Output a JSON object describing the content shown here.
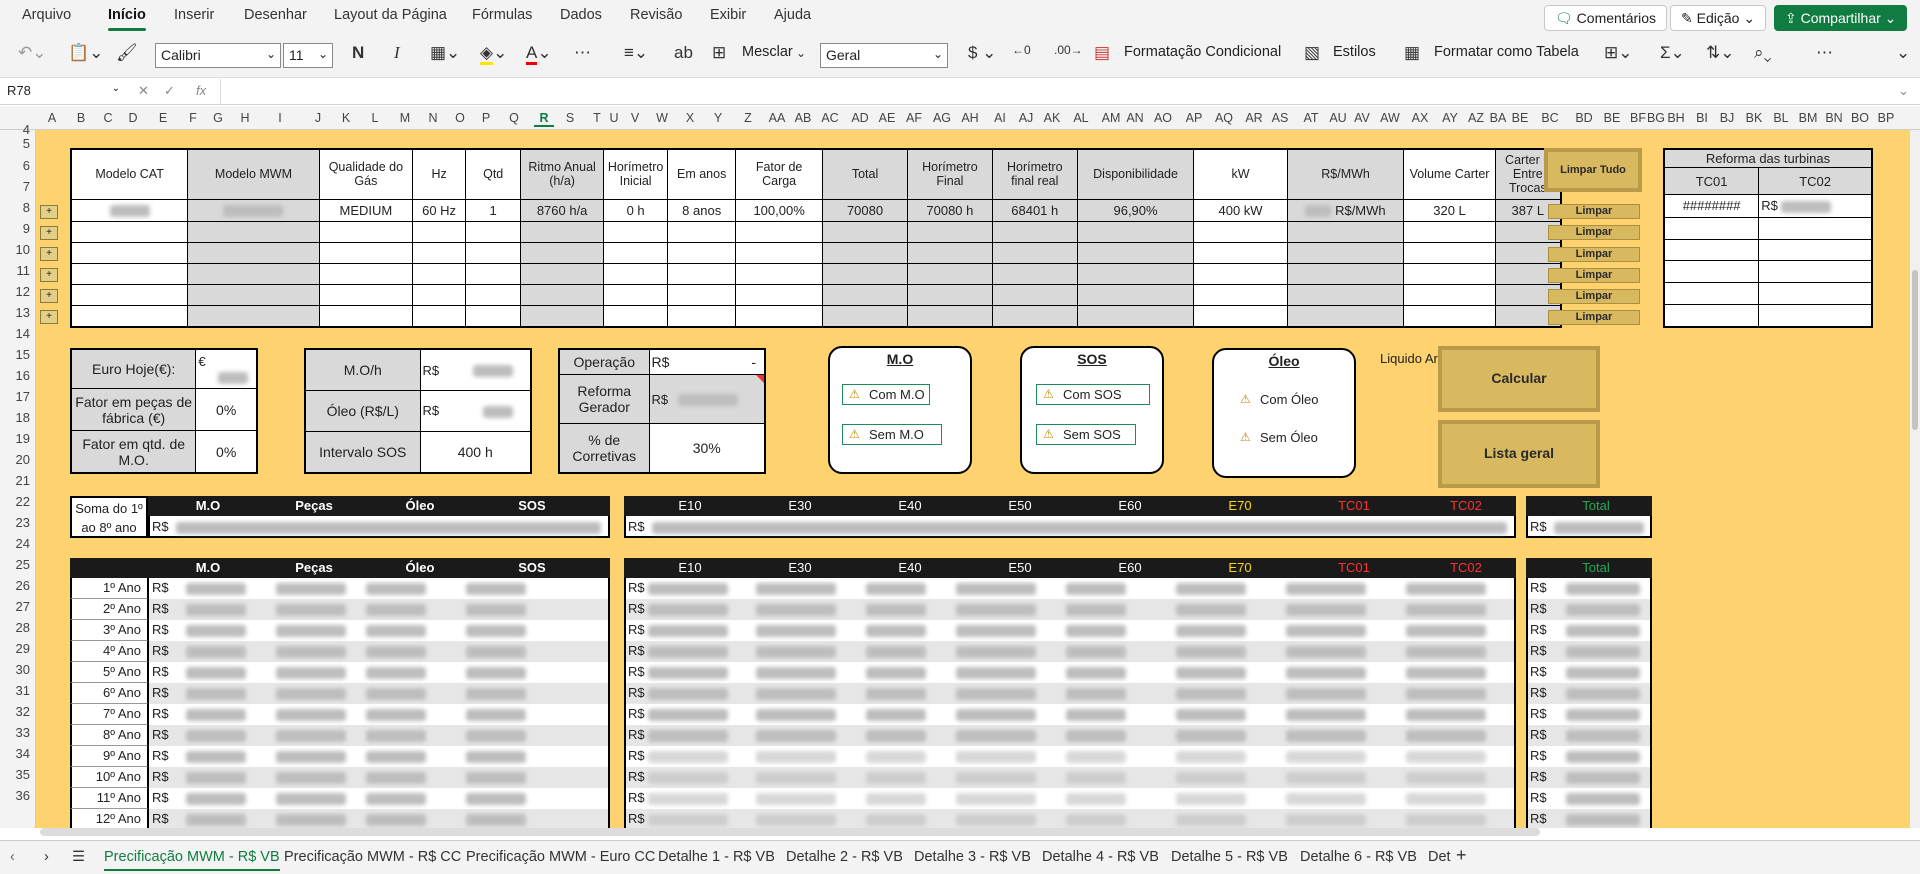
{
  "ribbon": {
    "tabs": [
      "Arquivo",
      "Início",
      "Inserir",
      "Desenhar",
      "Layout da Página",
      "Fórmulas",
      "Dados",
      "Revisão",
      "Exibir",
      "Ajuda"
    ],
    "comments": "Comentários",
    "edit": "Edição",
    "share": "Compartilhar"
  },
  "toolbar": {
    "font": "Calibri",
    "size": "11",
    "merge": "Mesclar",
    "format": "Geral",
    "cond_format": "Formatação Condicional",
    "styles": "Estilos",
    "format_table": "Formatar como Tabela"
  },
  "formula": {
    "cell": "R78",
    "fx": "fx"
  },
  "columns": [
    "A",
    "B",
    "C",
    "D",
    "E",
    "F",
    "G",
    "H",
    "I",
    "J",
    "K",
    "L",
    "M",
    "N",
    "O",
    "P",
    "Q",
    "R",
    "S",
    "T",
    "U",
    "V",
    "W",
    "X",
    "Y",
    "Z",
    "AA",
    "AB",
    "AC",
    "AD",
    "AE",
    "AF",
    "AG",
    "AH",
    "AI",
    "AJ",
    "AK",
    "AL",
    "AM",
    "AN",
    "AO",
    "AP",
    "AQ",
    "AR",
    "AS",
    "AT",
    "AU",
    "AV",
    "AW",
    "AX",
    "AY",
    "AZ",
    "BA",
    "BE",
    "BC",
    "BD",
    "BE",
    "BF",
    "BG",
    "BH",
    "BI",
    "BJ",
    "BK",
    "BL",
    "BM",
    "BN",
    "BO",
    "BP"
  ],
  "rows": [
    "4",
    "5",
    "6",
    "7",
    "8",
    "9",
    "10",
    "11",
    "12",
    "13",
    "14",
    "15",
    "16",
    "17",
    "18",
    "19",
    "20",
    "21",
    "22",
    "23",
    "24",
    "25",
    "26",
    "27",
    "28",
    "29",
    "30",
    "31",
    "32",
    "33",
    "34",
    "35",
    "36"
  ],
  "main_table": {
    "headers": [
      "Modelo CAT",
      "Modelo MWM",
      "Qualidade do Gás",
      "Hz",
      "Qtd",
      "Ritmo Anual (h/a)",
      "Horímetro Inicial",
      "Em anos",
      "Fator de Carga",
      "Total",
      "Horímetro Final",
      "Horímetro final real",
      "Disponibilidade",
      "kW",
      "R$/MWh",
      "Volume Carter",
      "Carter + Entre Trocas"
    ],
    "row": [
      "",
      "",
      "MEDIUM",
      "60 Hz",
      "1",
      "8760 h/a",
      "0 h",
      "8 anos",
      "100,00%",
      "70080",
      "70080 h",
      "68401 h",
      "96,90%",
      "400 kW",
      "R$/MWh",
      "320 L",
      "387 L"
    ]
  },
  "buttons": {
    "limpar_tudo": "Limpar Tudo",
    "limpar": "Limpar",
    "calcular": "Calcular",
    "lista_geral": "Lista geral",
    "plus": "+"
  },
  "turbinas": {
    "title": "Reforma das turbinas",
    "tc01": "TC01",
    "tc02": "TC02",
    "v1": "########",
    "v2": "R$"
  },
  "params": {
    "euro_label": "Euro Hoje(€):",
    "euro_sym": "€",
    "fator_pecas": "Fator em peças de fábrica (€)",
    "fator_pecas_val": "0%",
    "fator_qtd": "Fator em qtd. de M.O.",
    "fator_qtd_val": "0%",
    "mo_h": "M.O/h",
    "oleo": "Óleo (R$/L)",
    "intervalo": "Intervalo SOS",
    "intervalo_val": "400 h",
    "rs": "R$",
    "operacao": "Operação",
    "operacao_val": "-",
    "reforma": "Reforma Gerador",
    "corretivas": "% de Corretivas",
    "corretivas_val": "30%"
  },
  "groups": {
    "mo": {
      "title": "M.O",
      "a": "Com M.O",
      "b": "Sem M.O"
    },
    "sos": {
      "title": "SOS",
      "a": "Com SOS",
      "b": "Sem SOS"
    },
    "oleo": {
      "title": "Óleo",
      "a": "Com Óleo",
      "b": "Sem Óleo"
    },
    "liquido": "Liquido Arrefecimento"
  },
  "summary": {
    "label": "Soma do 1º ao 8º ano",
    "cols": [
      "M.O",
      "Peças",
      "Óleo",
      "SOS"
    ],
    "cols2": [
      "E10",
      "E30",
      "E40",
      "E50",
      "E60",
      "E70",
      "TC01",
      "TC02"
    ],
    "total": "Total",
    "rs": "R$"
  },
  "years": [
    "1º Ano",
    "2º Ano",
    "3º Ano",
    "4º Ano",
    "5º Ano",
    "6º Ano",
    "7º Ano",
    "8º Ano",
    "9º Ano",
    "10º Ano",
    "11º Ano",
    "12º Ano"
  ],
  "sheets": [
    "Precificação MWM - R$ VB",
    "Precificação MWM - R$ CC",
    "Precificação MWM - Euro CC",
    "Detalhe 1 - R$ VB",
    "Detalhe 2 - R$ VB",
    "Detalhe 3 - R$ VB",
    "Detalhe 4 - R$ VB",
    "Detalhe 5 - R$ VB",
    "Detalhe 6 - R$ VB",
    "Det"
  ],
  "colors": {
    "accent": "#107c41",
    "sheet_bg": "#fdd26f",
    "e70": "#ffd700",
    "tc": "#ff3333",
    "total": "#22aa55"
  }
}
